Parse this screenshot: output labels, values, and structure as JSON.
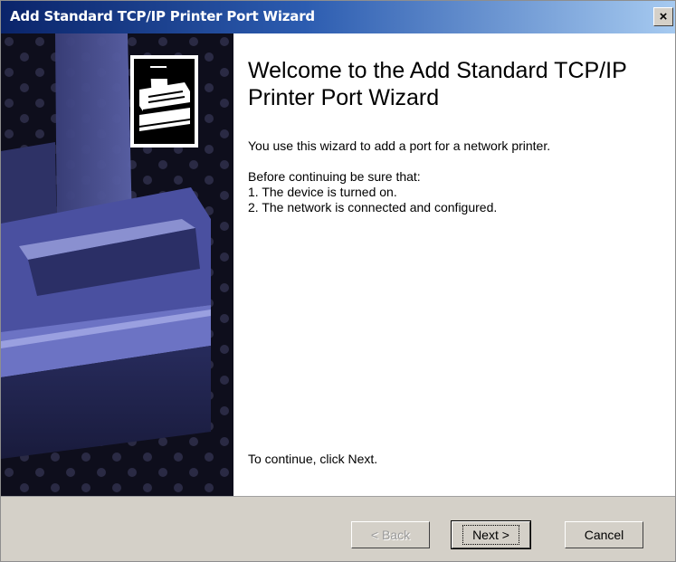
{
  "window": {
    "title": "Add Standard TCP/IP Printer Port Wizard",
    "close_label": "×"
  },
  "colors": {
    "titlebar_start": "#0a246a",
    "titlebar_end": "#a6caf0",
    "banner_background": "#0e0e1c",
    "dialog_face": "#d4d0c8"
  },
  "banner": {
    "icon": "printer-icon",
    "art": "printer-illustration"
  },
  "content": {
    "heading": "Welcome to the Add Standard TCP/IP Printer Port Wizard",
    "intro": "You use this wizard to add a port for a network printer.",
    "before_label": "Before continuing be sure that:",
    "checklist": [
      "1.  The device is turned on.",
      "2.  The network is connected and configured."
    ],
    "continue_hint": "To continue, click Next."
  },
  "buttons": {
    "back": "< Back",
    "next": "Next >",
    "cancel": "Cancel"
  }
}
